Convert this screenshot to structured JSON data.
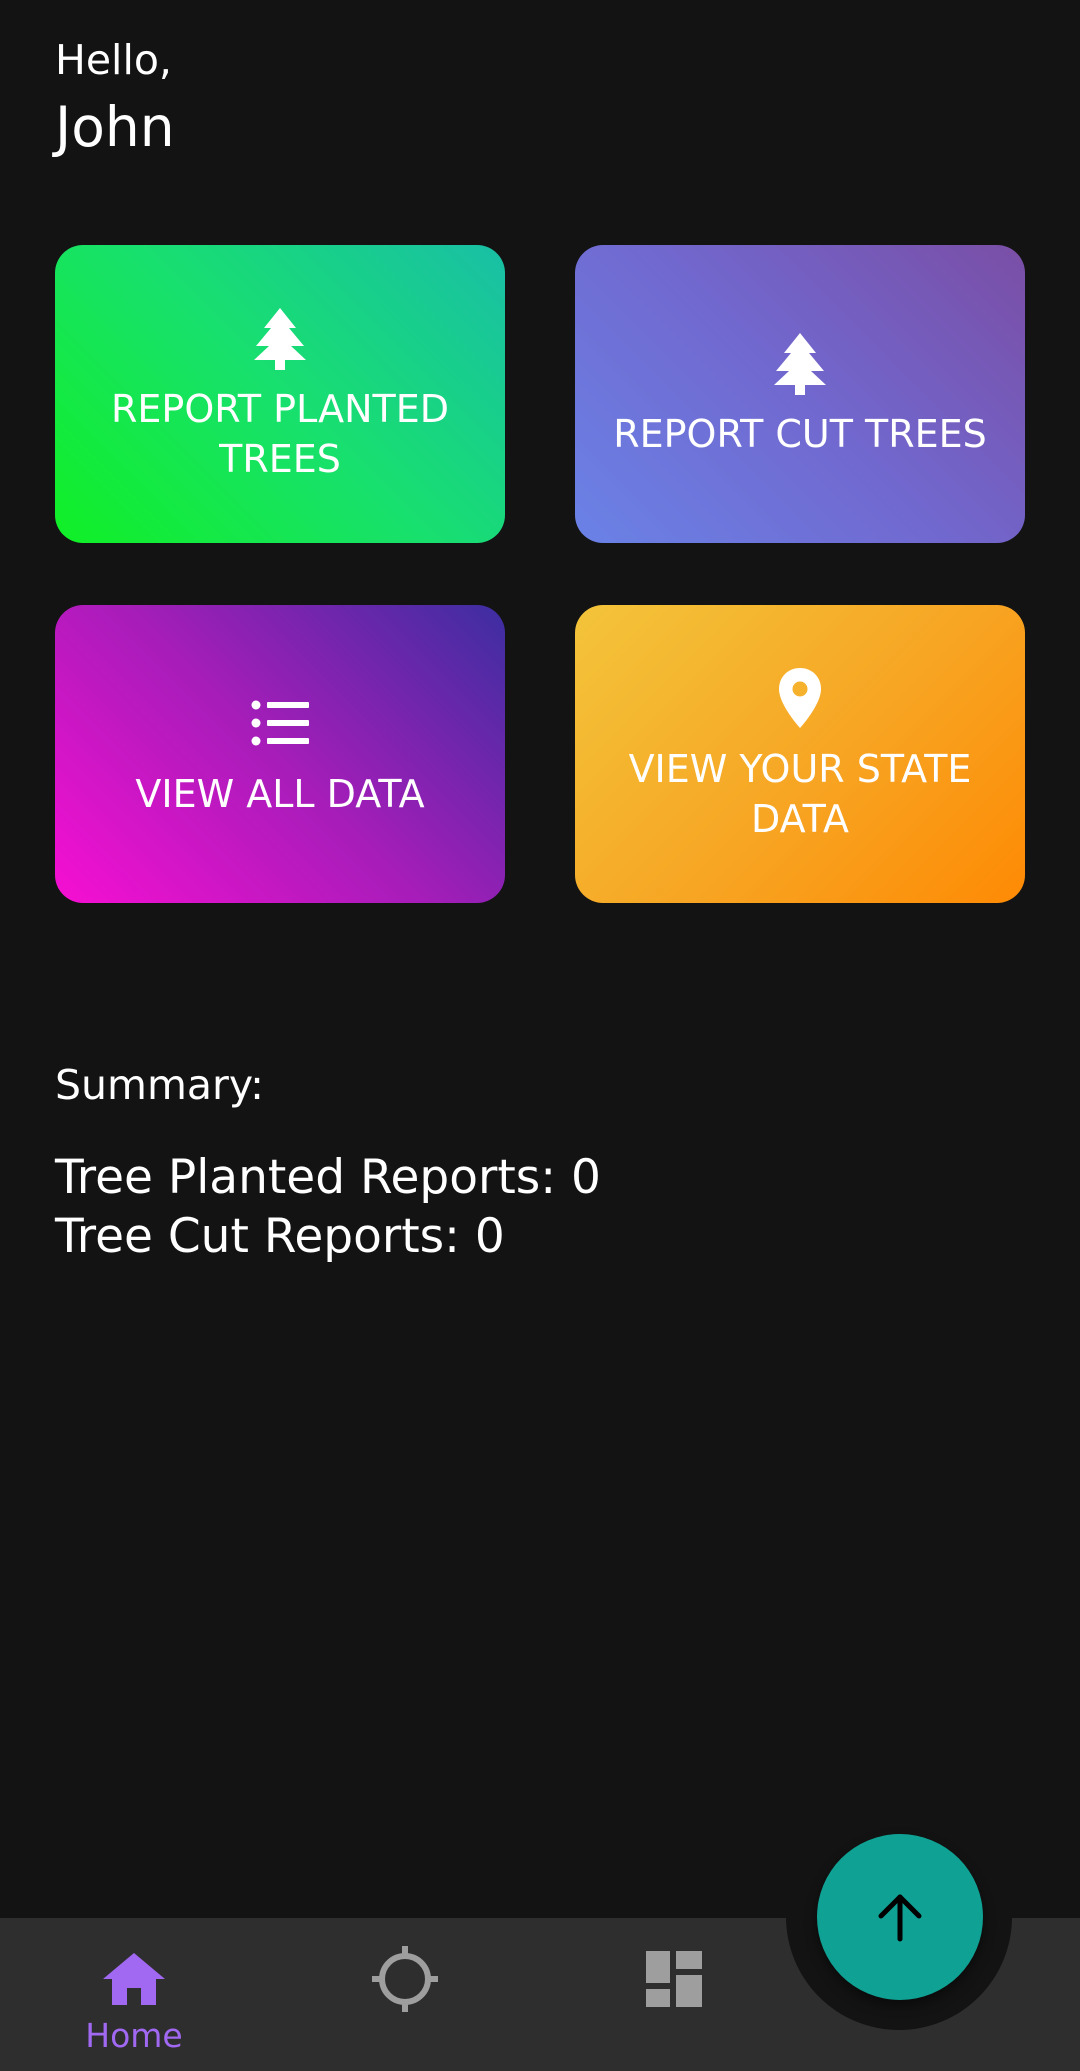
{
  "header": {
    "greeting": "Hello,",
    "username": "John"
  },
  "cards": [
    {
      "label": "REPORT PLANTED TREES",
      "icon": "tree-icon"
    },
    {
      "label": "REPORT CUT TREES",
      "icon": "tree-icon"
    },
    {
      "label": "VIEW ALL DATA",
      "icon": "list-icon"
    },
    {
      "label": "VIEW YOUR STATE DATA",
      "icon": "location-pin-icon"
    }
  ],
  "summary": {
    "title": "Summary:",
    "planted_line": "Tree Planted Reports: 0",
    "cut_line": "Tree Cut Reports: 0"
  },
  "nav": {
    "items": [
      {
        "label": "Home",
        "icon": "home-icon",
        "active": true
      },
      {
        "label": "",
        "icon": "crosshair-icon",
        "active": false
      },
      {
        "label": "",
        "icon": "dashboard-icon",
        "active": false
      }
    ],
    "fab_icon": "arrow-up-icon"
  },
  "colors": {
    "background": "#131313",
    "nav_background": "#2e2e2e",
    "active_nav": "#a168f2",
    "inactive_nav": "#9e9e9e",
    "fab": "#0fa294"
  }
}
